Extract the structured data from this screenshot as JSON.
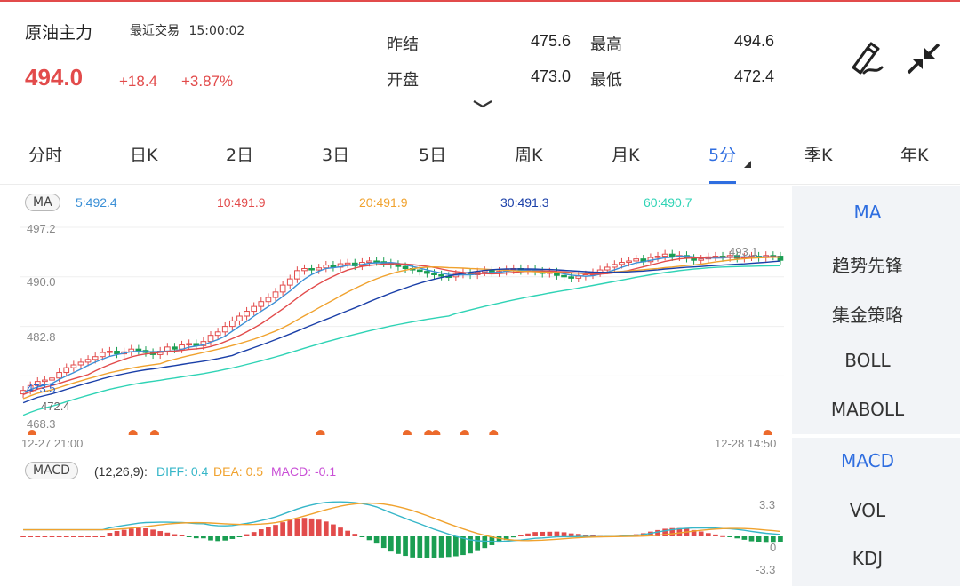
{
  "header": {
    "title": "原油主力",
    "recent_label": "最近交易",
    "time": "15:00:02",
    "last_price": "494.0",
    "change": "+18.4",
    "change_pct": "+3.87%",
    "quotes": [
      {
        "label": "昨结",
        "value": "475.6"
      },
      {
        "label": "最高",
        "value": "494.6"
      },
      {
        "label": "开盘",
        "value": "473.0"
      },
      {
        "label": "最低",
        "value": "472.4"
      }
    ],
    "icons": [
      "pen-draw-icon",
      "collapse-arrows-icon",
      "chevron-down-icon"
    ],
    "accent_up": "#e24b4b",
    "accent_down": "#1a9e52"
  },
  "tabs": [
    "分时",
    "日K",
    "2日",
    "3日",
    "5日",
    "周K",
    "月K",
    "5分",
    "季K",
    "年K"
  ],
  "active_tab": "5分",
  "ma_legend": [
    {
      "label": "5:492.4",
      "color": "#3a8fd6"
    },
    {
      "label": "10:491.9",
      "color": "#e24b4b"
    },
    {
      "label": "20:491.9",
      "color": "#f0a22e"
    },
    {
      "label": "30:491.3",
      "color": "#1a3fa8"
    },
    {
      "label": "60:490.7",
      "color": "#2fd3b5"
    }
  ],
  "main_chart": {
    "badge": "MA",
    "y_ticks": [
      "497.2",
      "490.0",
      "482.8",
      "468.3"
    ],
    "ylim": [
      468.3,
      497.2
    ],
    "x_start": "12-27 21:00",
    "x_end": "12-28 14:50",
    "high_label": "493.1",
    "low_label": "472.4",
    "last_label": "473.5"
  },
  "macd_chart": {
    "badge": "MACD",
    "params": "(12,26,9):",
    "diff": "DIFF: 0.4",
    "dea": "DEA: 0.5",
    "macd": "MACD: -0.1",
    "diff_color": "#36b6c8",
    "dea_color": "#f0a22e",
    "macd_color": "#c94fd6",
    "y_ticks": [
      "3.3",
      "0",
      "-3.3"
    ]
  },
  "side_panel_top": [
    "MA",
    "趋势先锋",
    "集金策略",
    "BOLL",
    "MABOLL"
  ],
  "side_panel_bottom": [
    "MACD",
    "VOL",
    "KDJ"
  ],
  "chart_data": [
    {
      "type": "candlestick",
      "title": "",
      "ylim": [
        468.3,
        497.2
      ],
      "close": [
        473.5,
        474.2,
        474.8,
        475.0,
        475.3,
        476.1,
        476.8,
        477.2,
        477.6,
        478.0,
        478.4,
        479.0,
        479.2,
        478.8,
        479.1,
        479.5,
        479.3,
        479.0,
        478.7,
        479.2,
        479.8,
        479.5,
        480.1,
        480.3,
        480.0,
        480.6,
        481.5,
        482.0,
        482.8,
        483.6,
        484.3,
        485.0,
        485.7,
        486.4,
        487.0,
        487.8,
        488.8,
        489.7,
        490.9,
        491.2,
        491.0,
        491.3,
        491.7,
        491.4,
        491.9,
        492.0,
        491.6,
        492.1,
        492.3,
        492.2,
        492.0,
        491.8,
        491.5,
        491.2,
        491.0,
        490.8,
        490.5,
        490.3,
        490.1,
        490.0,
        490.4,
        490.6,
        490.3,
        490.7,
        490.9,
        490.6,
        490.8,
        491.0,
        491.2,
        490.9,
        491.1,
        490.8,
        490.5,
        490.7,
        490.2,
        490.0,
        489.8,
        490.1,
        490.3,
        490.6,
        491.0,
        491.4,
        491.8,
        492.1,
        492.3,
        492.6,
        492.2,
        492.8,
        493.0,
        493.3,
        492.9,
        493.1,
        492.7,
        492.4,
        492.6,
        492.9,
        493.0,
        492.8,
        493.1,
        492.7,
        492.9,
        493.0,
        492.8,
        493.1,
        493.0,
        492.4
      ],
      "ma_values": {
        "5": 492.4,
        "10": 491.9,
        "20": 491.9,
        "30": 491.3,
        "60": 490.7
      },
      "signal_markers": 10
    },
    {
      "type": "bar",
      "title": "MACD",
      "series": [
        {
          "name": "DIFF",
          "last": 0.4
        },
        {
          "name": "DEA",
          "last": 0.5
        },
        {
          "name": "MACD",
          "last": -0.1
        }
      ],
      "ylim": [
        -3.3,
        3.3
      ]
    }
  ]
}
